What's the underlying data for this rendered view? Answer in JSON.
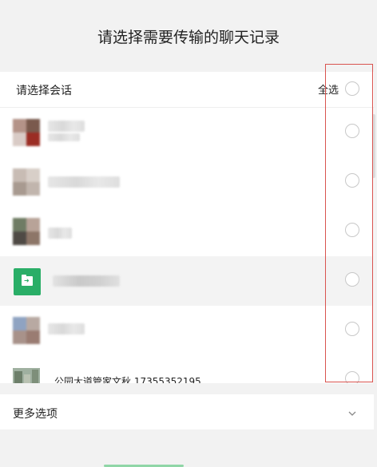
{
  "dialog": {
    "title": "请选择需要传输的聊天记录"
  },
  "selection": {
    "header_label": "请选择会话",
    "select_all_label": "全选"
  },
  "conversations": [
    {
      "name": "",
      "avatar": "blurred-avatar"
    },
    {
      "name": "",
      "avatar": "blurred-avatar"
    },
    {
      "name": "",
      "avatar": "blurred-avatar"
    },
    {
      "name": "",
      "avatar": "file-transfer-icon",
      "highlighted": true
    },
    {
      "name": "",
      "avatar": "blurred-avatar"
    },
    {
      "name": "公园大道管家文秋 17355352195",
      "avatar": "photo-avatar"
    }
  ],
  "more_options": {
    "label": "更多选项"
  },
  "colors": {
    "accent_green": "#2aae67",
    "annotation_red": "#d9534f"
  }
}
